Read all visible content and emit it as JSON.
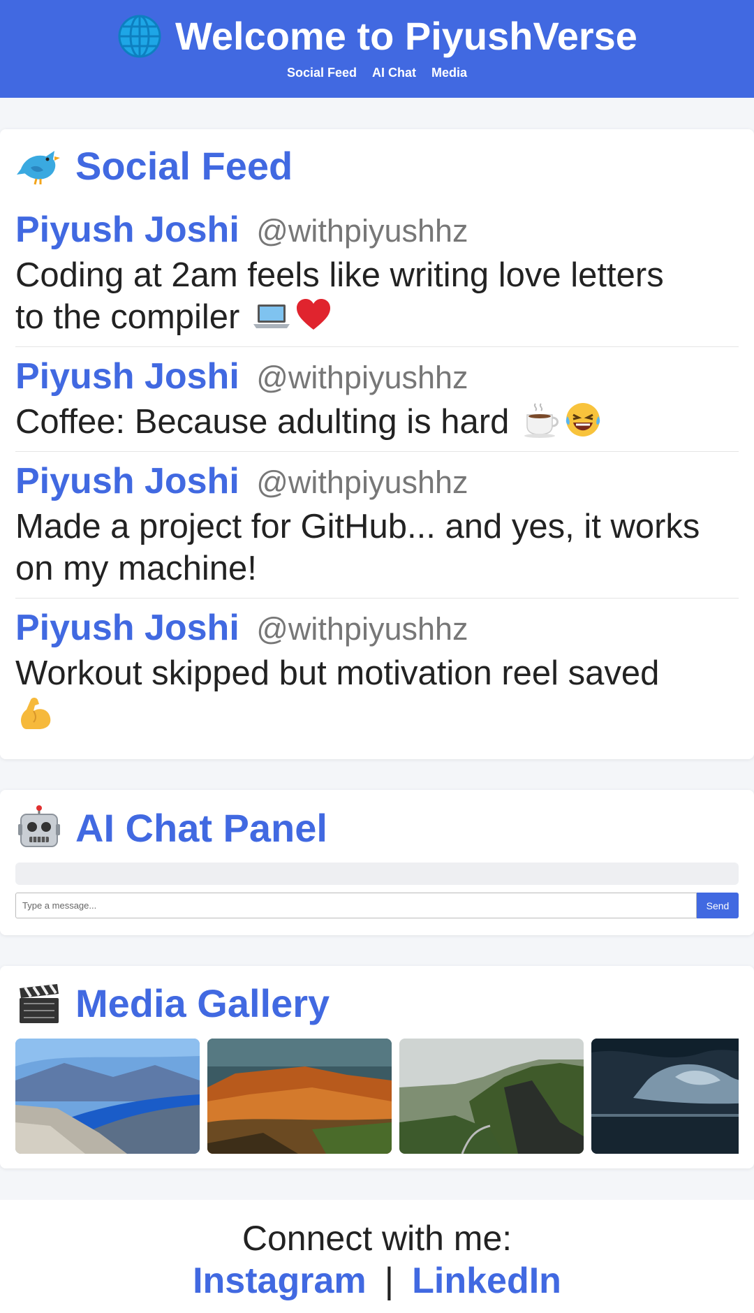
{
  "header": {
    "title": "Welcome to PiyushVerse",
    "icon": "globe-icon",
    "nav": [
      "Social Feed",
      "AI Chat",
      "Media"
    ]
  },
  "social_feed": {
    "title": "Social Feed",
    "icon": "bird-icon",
    "posts": [
      {
        "author": "Piyush Joshi",
        "handle": "@withpiyushhz",
        "text_line1": "Coding at 2am feels like writing love letters",
        "text_line2": "to the compiler",
        "emojis": [
          "laptop-icon",
          "heart-icon"
        ]
      },
      {
        "author": "Piyush Joshi",
        "handle": "@withpiyushhz",
        "text_line1": "Coffee: Because adulting is hard",
        "emojis": [
          "coffee-icon",
          "laughing-face-icon"
        ]
      },
      {
        "author": "Piyush Joshi",
        "handle": "@withpiyushhz",
        "text_line1": "Made a project for GitHub... and yes, it works",
        "text_line2": "on my machine!"
      },
      {
        "author": "Piyush Joshi",
        "handle": "@withpiyushhz",
        "text_line1": "Workout skipped but motivation reel saved",
        "emojis": [
          "flexed-bicep-icon"
        ]
      }
    ]
  },
  "ai_chat": {
    "title": "AI Chat Panel",
    "icon": "robot-icon",
    "input_placeholder": "Type a message...",
    "input_value": "",
    "send_label": "Send"
  },
  "media": {
    "title": "Media Gallery",
    "icon": "clapper-board-icon",
    "images": [
      "fjord-landscape",
      "red-rock-canyon",
      "green-cliffs-road",
      "stormy-sea"
    ]
  },
  "footer": {
    "connect": "Connect with me:",
    "links": [
      "Instagram",
      "LinkedIn"
    ],
    "separator": "|"
  },
  "colors": {
    "accent": "#4169e1",
    "background": "#f4f6f9"
  }
}
